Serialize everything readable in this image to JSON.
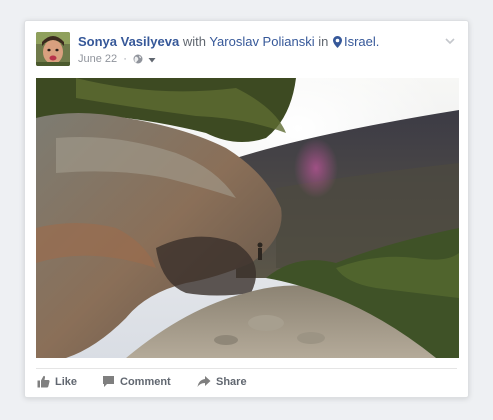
{
  "post": {
    "author": "Sonya Vasilyeva",
    "with_text": "with",
    "tagged": "Yaroslav Polianski",
    "in_text": "in",
    "location": "Israel.",
    "date": "June 22",
    "separator": "·"
  },
  "actions": {
    "like": "Like",
    "comment": "Comment",
    "share": "Share"
  },
  "icons": {
    "avatar": "profile-photo",
    "options": "chevron-down-icon",
    "location": "map-pin-icon",
    "audience": "globe-icon",
    "audience_menu": "caret-down-icon",
    "like": "thumbs-up-icon",
    "comment": "comment-bubble-icon",
    "share": "share-arrow-icon"
  },
  "colors": {
    "link": "#365899",
    "secondary_text": "#90949c",
    "action_text": "#616770",
    "card_border": "#dddfe2"
  }
}
